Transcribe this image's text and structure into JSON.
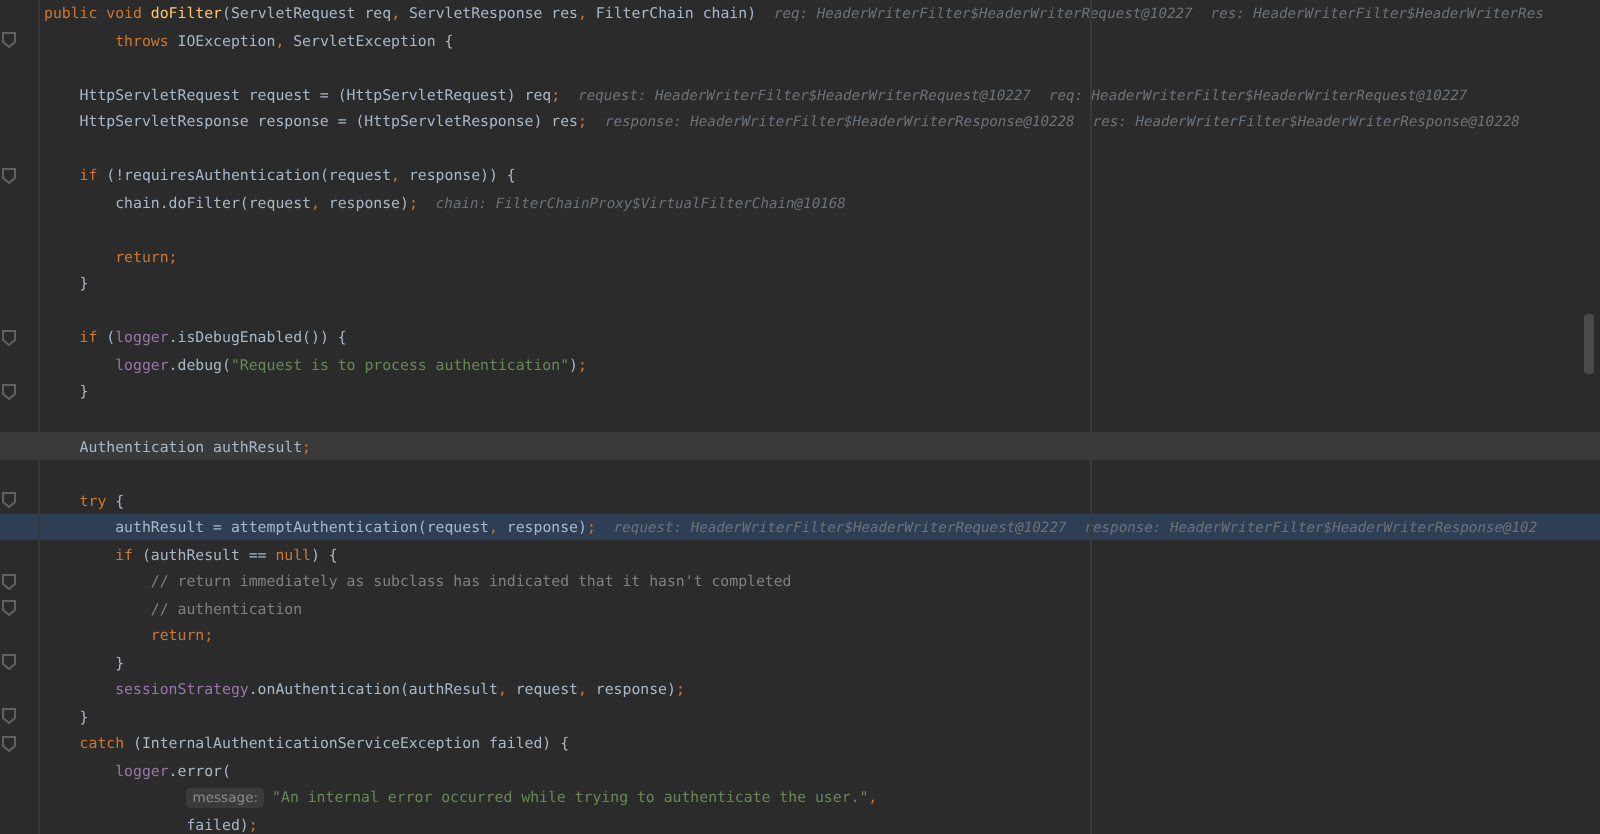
{
  "editor": {
    "lines": [
      {
        "current": false,
        "execution_point": false,
        "fold_marker": false,
        "tokens": [
          {
            "text": "public void ",
            "kind": "keyword"
          },
          {
            "text": "doFilter",
            "kind": "declaration"
          },
          {
            "text": "(ServletRequest req",
            "kind": "plain"
          },
          {
            "text": ", ",
            "kind": "punct"
          },
          {
            "text": "ServletResponse res",
            "kind": "plain"
          },
          {
            "text": ", ",
            "kind": "punct"
          },
          {
            "text": "FilterChain chain)",
            "kind": "plain"
          },
          {
            "text": "req: HeaderWriterFilter$HeaderWriterRequest@10227",
            "kind": "hint"
          },
          {
            "text": "res: HeaderWriterFilter$HeaderWriterRes",
            "kind": "hint"
          }
        ]
      },
      {
        "current": false,
        "execution_point": false,
        "fold_marker": true,
        "tokens": [
          {
            "text": "        throws ",
            "kind": "keyword"
          },
          {
            "text": "IOException",
            "kind": "plain"
          },
          {
            "text": ", ",
            "kind": "punct"
          },
          {
            "text": "ServletException {",
            "kind": "plain"
          }
        ]
      },
      {
        "current": false,
        "execution_point": false,
        "fold_marker": false
      },
      {
        "current": false,
        "execution_point": false,
        "fold_marker": false,
        "tokens": [
          {
            "text": "    HttpServletRequest request = (HttpServletRequest) req",
            "kind": "plain"
          },
          {
            "text": ";",
            "kind": "punct"
          },
          {
            "text": "request: HeaderWriterFilter$HeaderWriterRequest@10227",
            "kind": "hint"
          },
          {
            "text": "req: HeaderWriterFilter$HeaderWriterRequest@10227",
            "kind": "hint"
          }
        ]
      },
      {
        "current": false,
        "execution_point": false,
        "fold_marker": false,
        "tokens": [
          {
            "text": "    HttpServletResponse response = (HttpServletResponse) res",
            "kind": "plain"
          },
          {
            "text": ";",
            "kind": "punct"
          },
          {
            "text": "response: HeaderWriterFilter$HeaderWriterResponse@10228",
            "kind": "hint"
          },
          {
            "text": "res: HeaderWriterFilter$HeaderWriterResponse@10228",
            "kind": "hint"
          }
        ]
      },
      {
        "current": false,
        "execution_point": false,
        "fold_marker": false
      },
      {
        "current": false,
        "execution_point": false,
        "fold_marker": true,
        "tokens": [
          {
            "text": "    if ",
            "kind": "keyword"
          },
          {
            "text": "(!requiresAuthentication(request",
            "kind": "plain"
          },
          {
            "text": ", ",
            "kind": "punct"
          },
          {
            "text": "response)) {",
            "kind": "plain"
          }
        ]
      },
      {
        "current": false,
        "execution_point": false,
        "fold_marker": false,
        "tokens": [
          {
            "text": "        chain.doFilter(request",
            "kind": "plain"
          },
          {
            "text": ", ",
            "kind": "punct"
          },
          {
            "text": "response)",
            "kind": "plain"
          },
          {
            "text": ";",
            "kind": "punct"
          },
          {
            "text": "chain: FilterChainProxy$VirtualFilterChain@10168",
            "kind": "hint"
          }
        ]
      },
      {
        "current": false,
        "execution_point": false,
        "fold_marker": false
      },
      {
        "current": false,
        "execution_point": false,
        "fold_marker": false,
        "tokens": [
          {
            "text": "        return;",
            "kind": "keyword"
          }
        ]
      },
      {
        "current": false,
        "execution_point": false,
        "fold_marker": false,
        "tokens": [
          {
            "text": "    }",
            "kind": "plain"
          }
        ]
      },
      {
        "current": false,
        "execution_point": false,
        "fold_marker": false
      },
      {
        "current": false,
        "execution_point": false,
        "fold_marker": true,
        "tokens": [
          {
            "text": "    if ",
            "kind": "keyword"
          },
          {
            "text": "(",
            "kind": "plain"
          },
          {
            "text": "logger",
            "kind": "field"
          },
          {
            "text": ".isDebugEnabled()) {",
            "kind": "plain"
          }
        ]
      },
      {
        "current": false,
        "execution_point": false,
        "fold_marker": false,
        "tokens": [
          {
            "text": "        logger",
            "kind": "field"
          },
          {
            "text": ".debug(",
            "kind": "plain"
          },
          {
            "text": "\"Request is to process authentication\"",
            "kind": "string"
          },
          {
            "text": ")",
            "kind": "plain"
          },
          {
            "text": ";",
            "kind": "punct"
          }
        ]
      },
      {
        "current": false,
        "execution_point": false,
        "fold_marker": true,
        "tokens": [
          {
            "text": "    }",
            "kind": "plain"
          }
        ]
      },
      {
        "current": false,
        "execution_point": false,
        "fold_marker": false
      },
      {
        "current": true,
        "execution_point": false,
        "fold_marker": false,
        "tokens": [
          {
            "text": "    Authentication authResult",
            "kind": "plain"
          },
          {
            "text": ";",
            "kind": "punct"
          }
        ]
      },
      {
        "current": false,
        "execution_point": false,
        "fold_marker": false
      },
      {
        "current": false,
        "execution_point": false,
        "fold_marker": true,
        "tokens": [
          {
            "text": "    try ",
            "kind": "keyword"
          },
          {
            "text": "{",
            "kind": "plain"
          }
        ]
      },
      {
        "current": false,
        "execution_point": true,
        "fold_marker": false,
        "tokens": [
          {
            "text": "        authResult = attemptAuthentication(request",
            "kind": "plain"
          },
          {
            "text": ", ",
            "kind": "punct"
          },
          {
            "text": "response)",
            "kind": "plain"
          },
          {
            "text": ";",
            "kind": "punct"
          },
          {
            "text": "request: HeaderWriterFilter$HeaderWriterRequest@10227",
            "kind": "hint"
          },
          {
            "text": "response: HeaderWriterFilter$HeaderWriterResponse@102",
            "kind": "hint"
          }
        ]
      },
      {
        "current": false,
        "execution_point": false,
        "fold_marker": false,
        "tokens": [
          {
            "text": "        if ",
            "kind": "keyword"
          },
          {
            "text": "(authResult == ",
            "kind": "plain"
          },
          {
            "text": "null",
            "kind": "keyword"
          },
          {
            "text": ") {",
            "kind": "plain"
          }
        ]
      },
      {
        "current": false,
        "execution_point": false,
        "fold_marker": true,
        "tokens": [
          {
            "text": "            // return immediately as subclass has indicated that it hasn't completed",
            "kind": "comment"
          }
        ]
      },
      {
        "current": false,
        "execution_point": false,
        "fold_marker": true,
        "tokens": [
          {
            "text": "            // authentication",
            "kind": "comment"
          }
        ]
      },
      {
        "current": false,
        "execution_point": false,
        "fold_marker": false,
        "tokens": [
          {
            "text": "            return;",
            "kind": "keyword"
          }
        ]
      },
      {
        "current": false,
        "execution_point": false,
        "fold_marker": true,
        "tokens": [
          {
            "text": "        }",
            "kind": "plain"
          }
        ]
      },
      {
        "current": false,
        "execution_point": false,
        "fold_marker": false,
        "tokens": [
          {
            "text": "        sessionStrategy",
            "kind": "field"
          },
          {
            "text": ".onAuthentication(authResult",
            "kind": "plain"
          },
          {
            "text": ", ",
            "kind": "punct"
          },
          {
            "text": "request",
            "kind": "plain"
          },
          {
            "text": ", ",
            "kind": "punct"
          },
          {
            "text": "response)",
            "kind": "plain"
          },
          {
            "text": ";",
            "kind": "punct"
          }
        ]
      },
      {
        "current": false,
        "execution_point": false,
        "fold_marker": true,
        "tokens": [
          {
            "text": "    }",
            "kind": "plain"
          }
        ]
      },
      {
        "current": false,
        "execution_point": false,
        "fold_marker": true,
        "tokens": [
          {
            "text": "    catch ",
            "kind": "keyword"
          },
          {
            "text": "(InternalAuthenticationServiceException failed) {",
            "kind": "plain"
          }
        ]
      },
      {
        "current": false,
        "execution_point": false,
        "fold_marker": false,
        "tokens": [
          {
            "text": "        logger",
            "kind": "field"
          },
          {
            "text": ".error(",
            "kind": "plain"
          }
        ]
      },
      {
        "current": false,
        "execution_point": false,
        "fold_marker": false,
        "tokens": [
          {
            "text": "                \"An internal error occurred while trying to authenticate the user.\"",
            "kind": "string",
            "parameter_hint": "message:"
          },
          {
            "text": ",",
            "kind": "punct"
          }
        ]
      },
      {
        "current": false,
        "execution_point": false,
        "fold_marker": false,
        "tokens": [
          {
            "text": "                failed)",
            "kind": "plain"
          },
          {
            "text": ";",
            "kind": "punct"
          }
        ]
      }
    ]
  }
}
